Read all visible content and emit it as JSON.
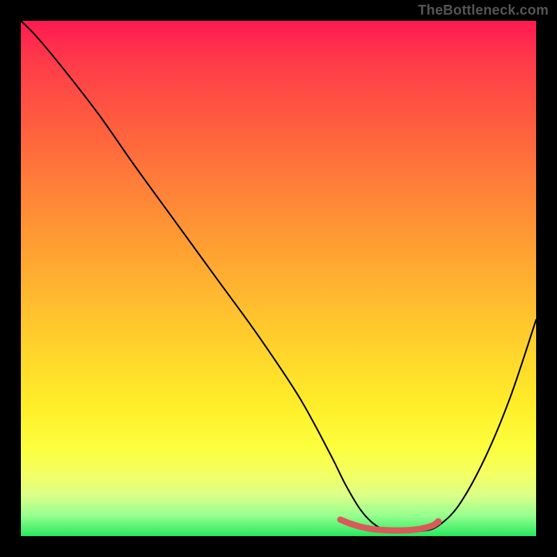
{
  "watermark": "TheBottleneck.com",
  "chart_data": {
    "type": "line",
    "title": "",
    "xlabel": "",
    "ylabel": "",
    "xlim": [
      0,
      100
    ],
    "ylim": [
      0,
      100
    ],
    "series": [
      {
        "name": "bottleneck-curve",
        "color": "#000000",
        "x": [
          0,
          3,
          8,
          15,
          22,
          30,
          38,
          46,
          54,
          60,
          63,
          66,
          69,
          72,
          75,
          78,
          81,
          85,
          90,
          95,
          100
        ],
        "y": [
          100,
          97,
          91,
          82,
          72,
          61,
          50,
          39,
          27,
          16,
          10,
          5,
          2,
          1,
          1,
          1,
          2,
          6,
          15,
          27,
          42
        ]
      },
      {
        "name": "optimal-range-marker",
        "color": "#d85a5a",
        "x": [
          62,
          64,
          66,
          68,
          70,
          72,
          74,
          76,
          78,
          80,
          81
        ],
        "y": [
          3.2,
          2.4,
          1.8,
          1.4,
          1.2,
          1.1,
          1.1,
          1.2,
          1.5,
          2.1,
          2.8
        ]
      }
    ],
    "annotations": [],
    "grid": false,
    "legend": false
  },
  "colors": {
    "background": "#000000",
    "curve": "#000000",
    "marker": "#d85a5a",
    "gradient_top": "#ff1a52",
    "gradient_bottom": "#28e85f"
  }
}
